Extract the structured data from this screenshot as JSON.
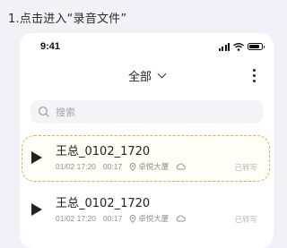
{
  "instruction": "1.点击进入“录音文件”",
  "statusbar": {
    "time": "9:41"
  },
  "header": {
    "title": "全部"
  },
  "search": {
    "placeholder": "搜索"
  },
  "recordings": [
    {
      "title": "王总_0102_1720",
      "date": "01/02 17:20",
      "duration": "00:17",
      "location": "卓悦大厦",
      "status": "已转写"
    },
    {
      "title": "王总_0102_1720",
      "date": "01/02 17:20",
      "duration": "00:17",
      "location": "卓悦大厦",
      "status": "已转写"
    }
  ]
}
